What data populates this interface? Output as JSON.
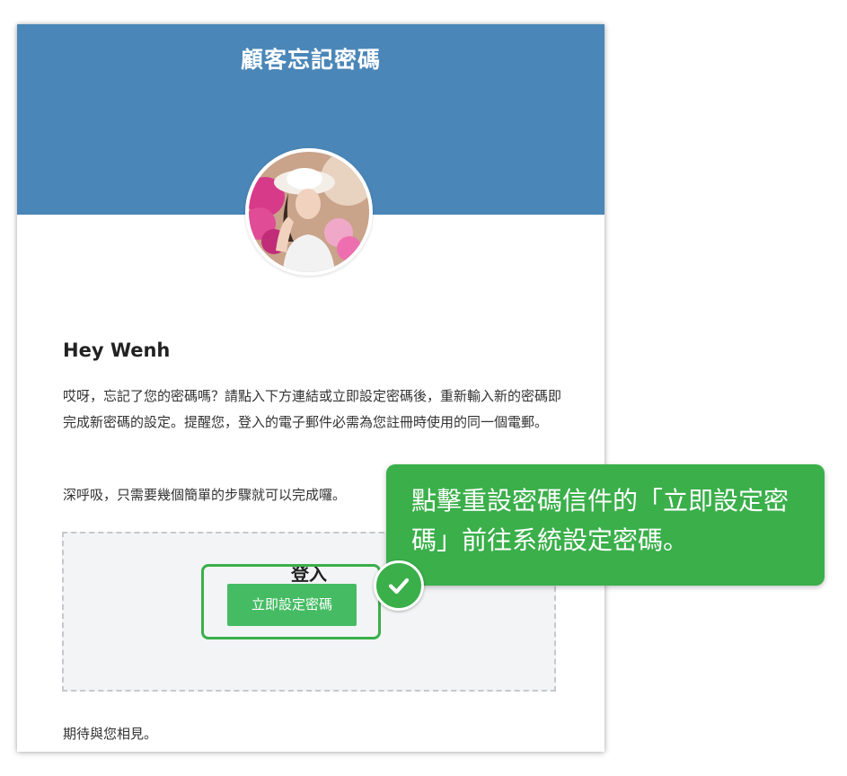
{
  "email": {
    "title": "顧客忘記密碼",
    "greeting": "Hey Wenh",
    "paragraph1": "哎呀，忘記了您的密碼嗎？請點入下方連結或立即設定密碼後，重新輸入新的密碼即完成新密碼的設定。提醒您，登入的電子郵件必需為您註冊時使用的同一個電郵。",
    "paragraph2": "深呼吸，只需要幾個簡單的步驟就可以完成囉。",
    "login_title": "登入",
    "set_password_label": "立即設定密碼",
    "sign_off": "期待與您相見。"
  },
  "callout": {
    "text": "點擊重設密碼信件的「立即設定密碼」前往系統設定密碼。"
  },
  "icons": {
    "avatar": "avatar-photo",
    "badge": "check-icon"
  },
  "colors": {
    "header": "#4a86b8",
    "accent_green": "#3aaf4a",
    "button_green": "#45bc64"
  }
}
